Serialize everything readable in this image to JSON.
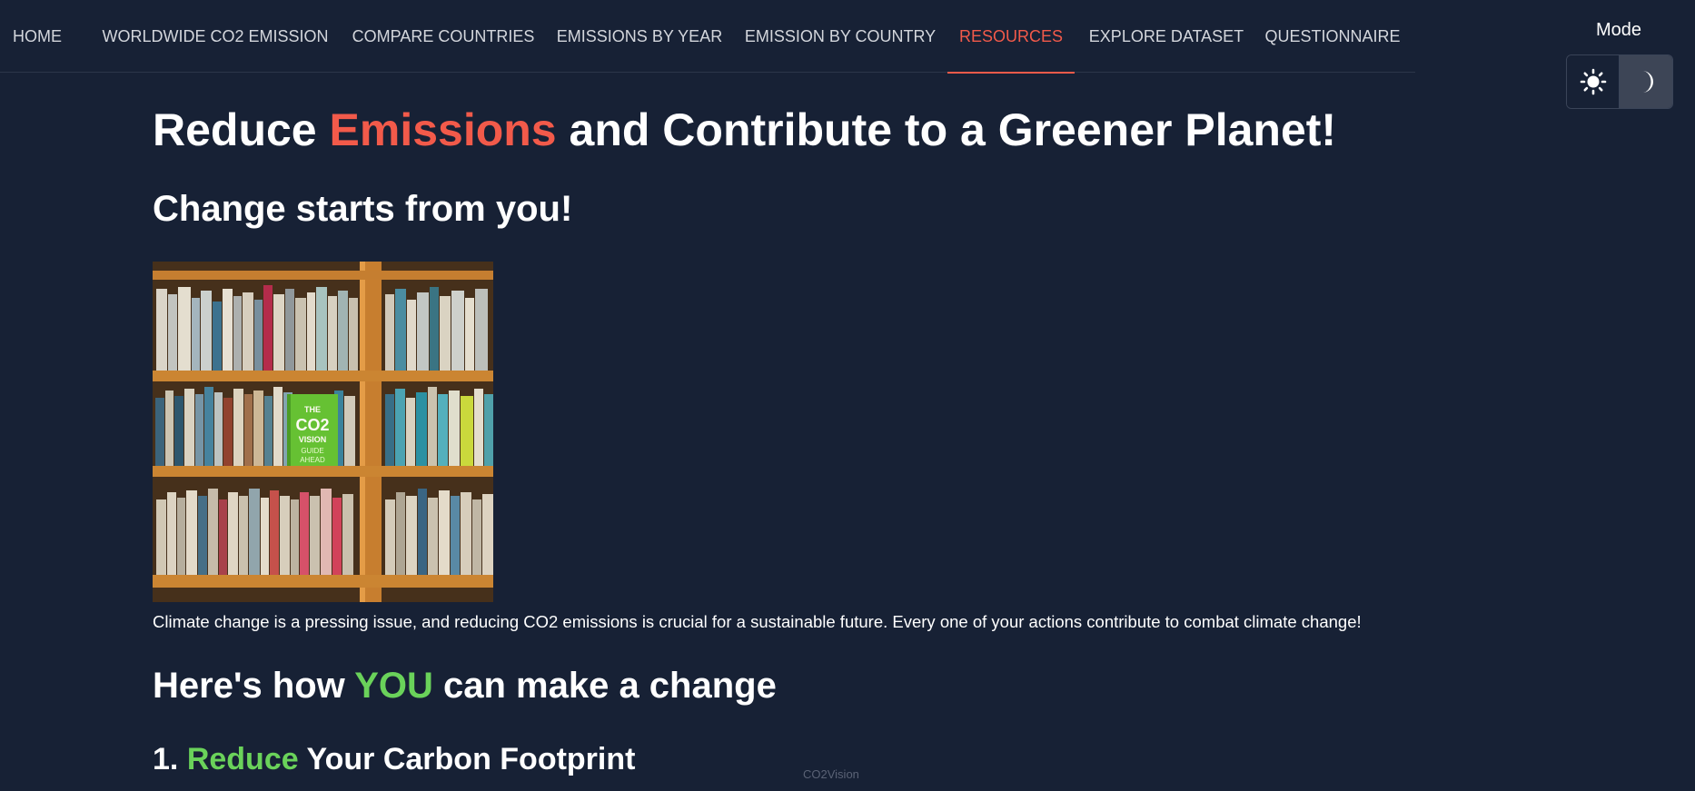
{
  "nav": {
    "items": [
      {
        "label": "HOME",
        "active": false
      },
      {
        "label": "WORLDWIDE CO2 EMISSION",
        "active": false
      },
      {
        "label": "COMPARE COUNTRIES",
        "active": false
      },
      {
        "label": "EMISSIONS BY YEAR",
        "active": false
      },
      {
        "label": "EMISSION BY COUNTRY",
        "active": false
      },
      {
        "label": "RESOURCES",
        "active": true
      },
      {
        "label": "EXPLORE DATASET",
        "active": false
      },
      {
        "label": "QUESTIONNAIRE",
        "active": false
      }
    ]
  },
  "mode": {
    "label": "Mode",
    "light_icon": "sun-icon",
    "dark_icon": "moon-icon",
    "selected": "dark"
  },
  "main": {
    "title_part1": "Reduce ",
    "title_accent": "Emissions",
    "title_part2": " and Contribute to a Greener Planet!",
    "subtitle": "Change starts from you!",
    "image_label": {
      "line1": "THE",
      "line2": "CO2",
      "line3": "VISION",
      "line4": "GUIDE",
      "line5": "AHEAD"
    },
    "intro": "Climate change is a pressing issue, and reducing CO2 emissions is crucial for a sustainable future. Every one of your actions contribute to combat climate change!",
    "howto_part1": "Here's how ",
    "howto_accent": "YOU",
    "howto_part2": " can make a change",
    "step1_number": "1. ",
    "step1_accent": "Reduce",
    "step1_rest": " Your Carbon Footprint"
  },
  "footer": {
    "brand": "CO2Vision"
  },
  "colors": {
    "background": "#172135",
    "accent_red": "#f25a4a",
    "accent_green": "#6ad25a",
    "nav_text": "#d3d6dc"
  }
}
